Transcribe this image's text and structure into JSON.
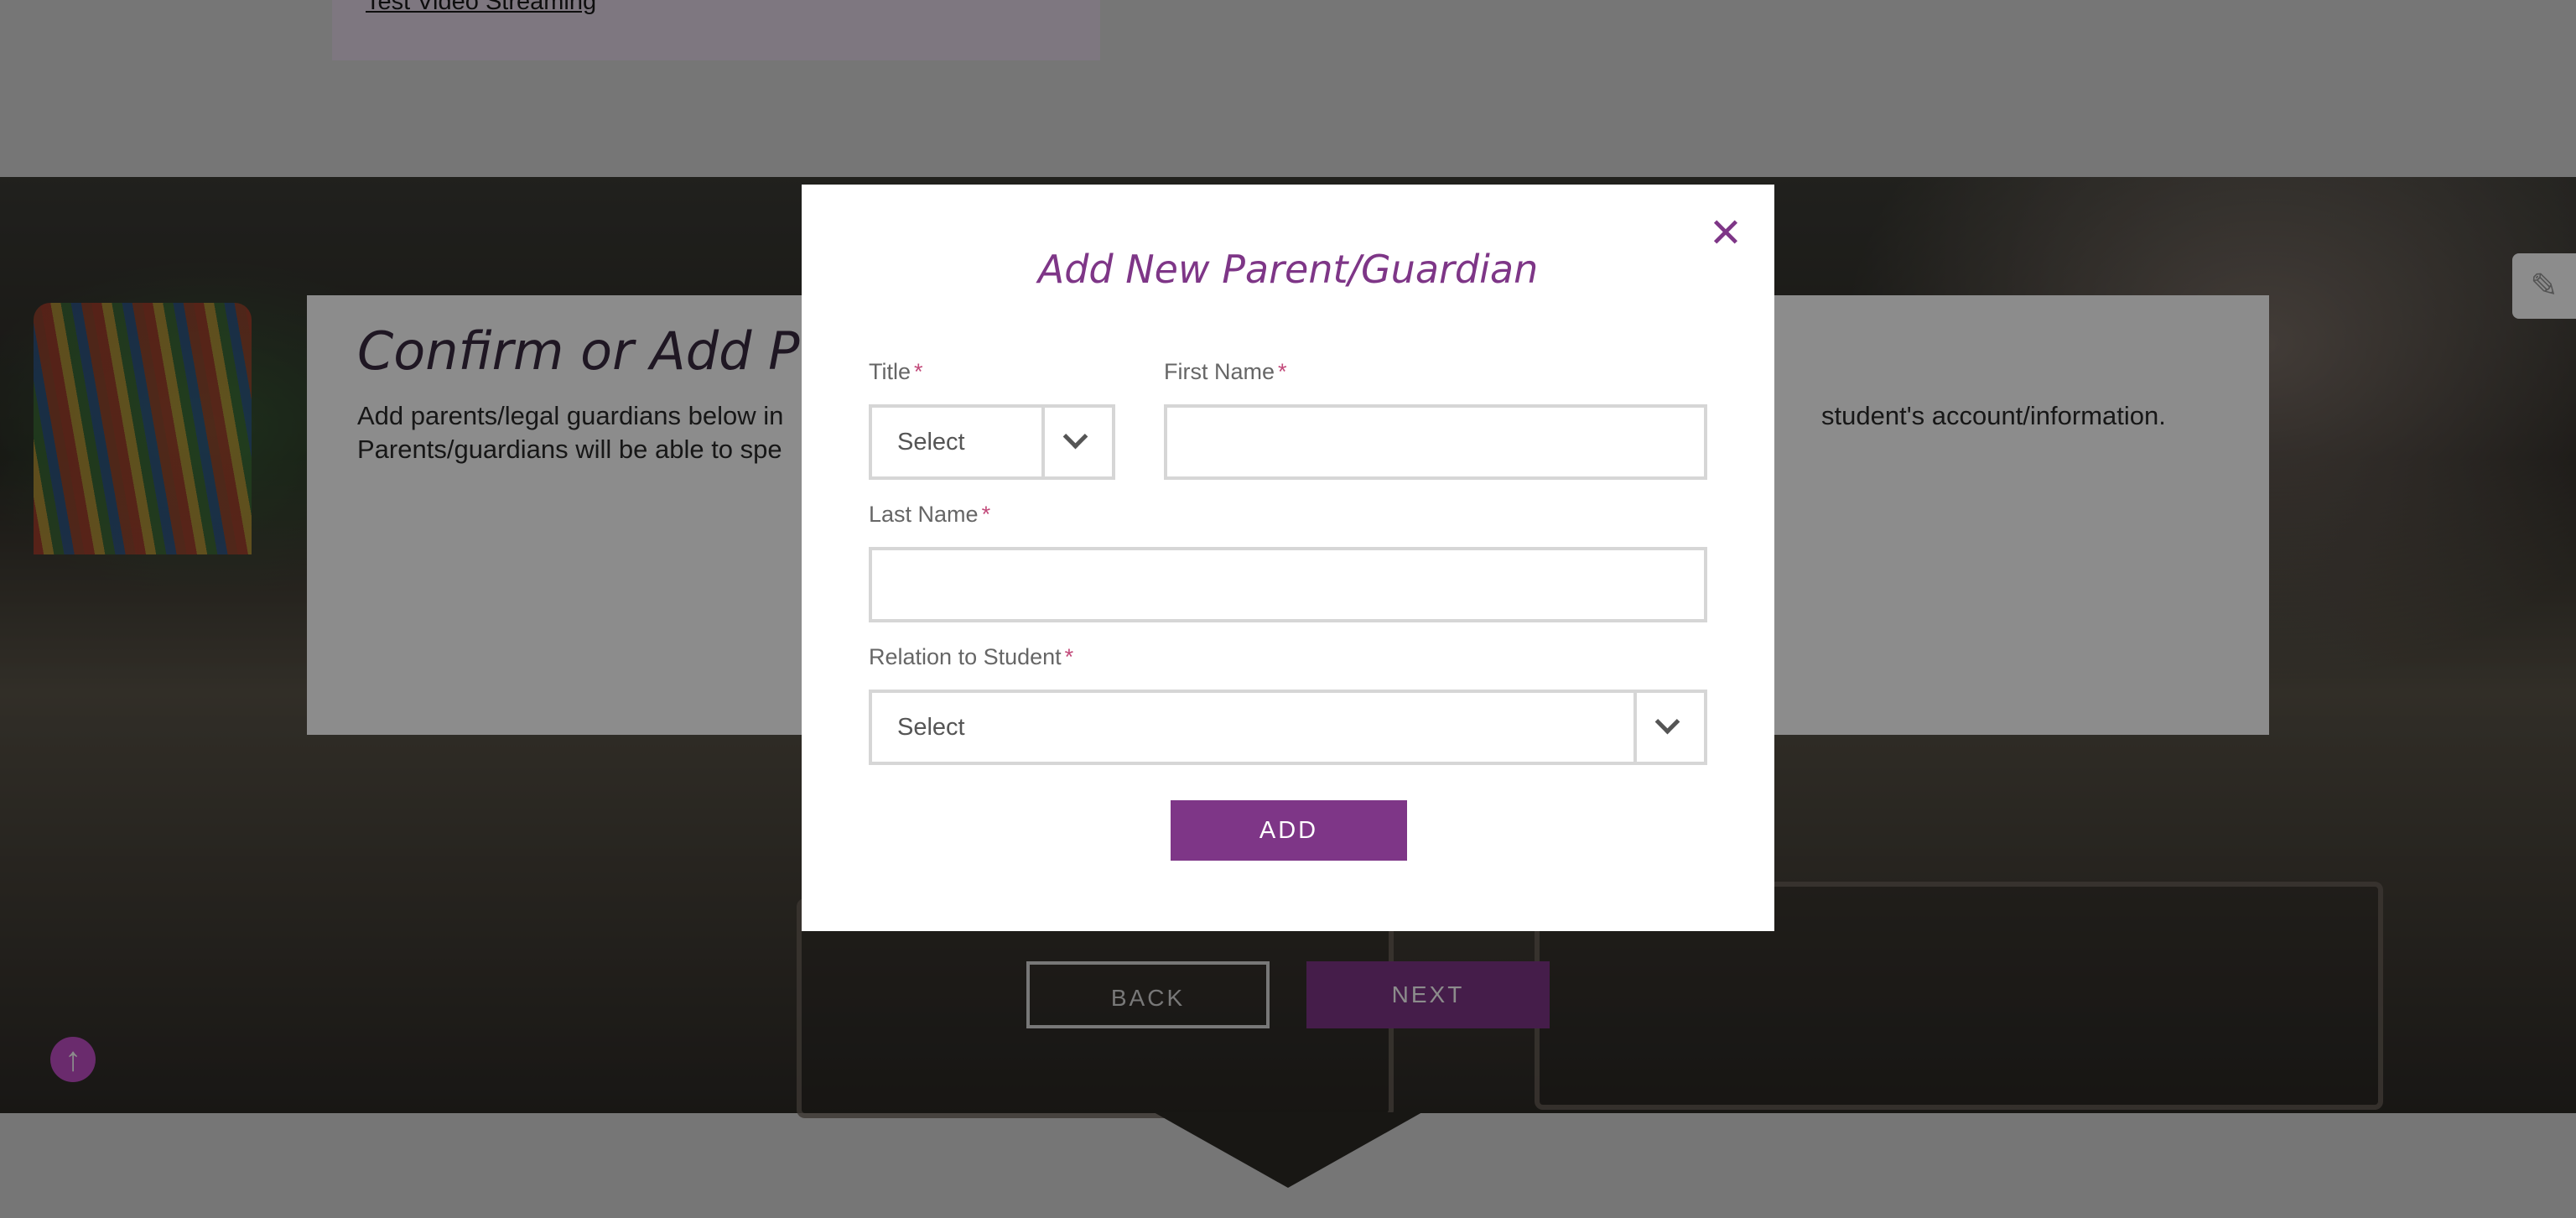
{
  "page": {
    "top_link": "Test Video Streaming",
    "section_title": "Confirm or Add Pare",
    "section_text_line1": "Add parents/legal guardians below in",
    "section_text_line1_right": "student's account/information.",
    "section_text_line2": "Parents/guardians will be able to spe",
    "back_label": "BACK",
    "next_label": "NEXT"
  },
  "modal": {
    "title": "Add New Parent/Guardian",
    "close_label": "✕",
    "title_field": {
      "label": "Title",
      "required": "*",
      "value": "Select"
    },
    "first_name": {
      "label": "First Name",
      "required": "*",
      "value": ""
    },
    "last_name": {
      "label": "Last Name",
      "required": "*",
      "value": ""
    },
    "relation": {
      "label": "Relation to Student",
      "required": "*",
      "value": "Select"
    },
    "add_label": "ADD"
  },
  "colors": {
    "accent": "#7e3687",
    "overlay": "rgba(0,0,0,0.45)"
  },
  "icons": {
    "close": "close-icon",
    "chevron": "chevron-down-icon",
    "scroll_top": "arrow-up-circle-icon",
    "side_tab": "tool-icon"
  }
}
